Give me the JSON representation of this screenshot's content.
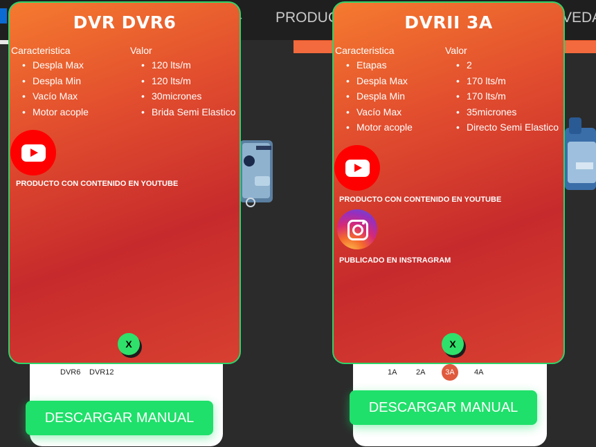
{
  "nav": {
    "items": [
      "PRODUC",
      "VEDA"
    ]
  },
  "cards": [
    {
      "sizes": [
        "DVR6",
        "DVR12"
      ],
      "download_label": "DESCARGAR MANUAL"
    },
    {
      "sizes": [
        "1A",
        "2A",
        "3A",
        "4A"
      ],
      "active_size": "3A",
      "download_label": "DESCARGAR MANUAL"
    }
  ],
  "popups": [
    {
      "title": "DVR DVR6",
      "col1_header": "Caracteristica",
      "col2_header": "Valor",
      "features": [
        "Despla Max",
        "Despla Min",
        "Vacío Max",
        "Motor acople"
      ],
      "values": [
        "120 lts/m",
        "120 lts/m",
        "30micrones",
        "Brida Semi Elastico"
      ],
      "youtube_caption": "PRODUCTO CON CONTENIDO EN YOUTUBE",
      "close_label": "X"
    },
    {
      "title": "DVRII 3A",
      "col1_header": "Caracteristica",
      "col2_header": "Valor",
      "features": [
        "Etapas",
        "Despla Max",
        "Despla Min",
        "Vacío Max",
        "Motor acople"
      ],
      "values": [
        "2",
        "170 lts/m",
        "170 lts/m",
        "35micrones",
        "Directo Semi Elastico"
      ],
      "youtube_caption": "PRODUCTO CON CONTENIDO EN YOUTUBE",
      "instagram_caption": "PUBLICADO EN INSTRAGRAM",
      "close_label": "X"
    }
  ],
  "colors": {
    "popup_border": "#2fd36a",
    "download_button": "#1fe06a",
    "accent_orange": "#f26a3d",
    "active_size": "#e05a3d"
  }
}
